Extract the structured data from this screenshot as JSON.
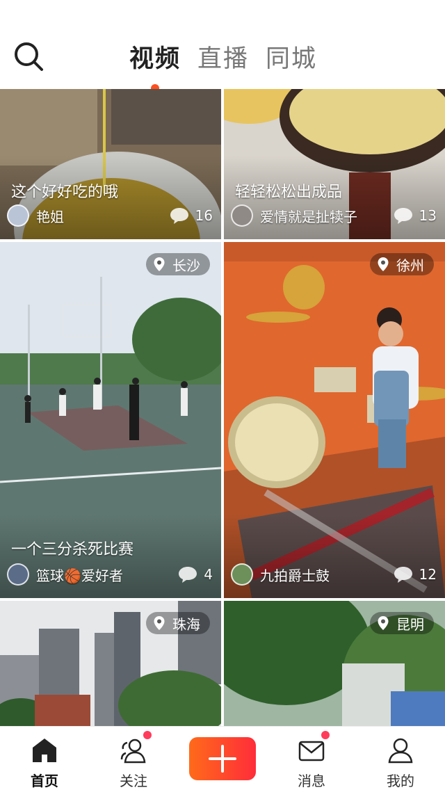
{
  "tabs": [
    "视频",
    "直播",
    "同城"
  ],
  "cards": [
    {
      "caption": "这个好好吃的哦",
      "author": "艳姐",
      "comments": "16"
    },
    {
      "caption": "轻轻松松出成品",
      "author": "爱情就是扯犊子",
      "comments": "13"
    },
    {
      "caption": "一个三分杀死比赛",
      "author": "篮球🏀爱好者",
      "comments": "4",
      "location": "长沙"
    },
    {
      "author": "九拍爵士鼓",
      "comments": "12",
      "location": "徐州"
    },
    {
      "location": "珠海"
    },
    {
      "location": "昆明"
    }
  ],
  "nav": {
    "home": "首页",
    "follow": "关注",
    "messages": "消息",
    "me": "我的"
  },
  "colors": {
    "accent": "#ff4f1f",
    "plus_start": "#ff6a1a",
    "plus_end": "#ff2d3a",
    "badge": "#ff3b5c"
  }
}
